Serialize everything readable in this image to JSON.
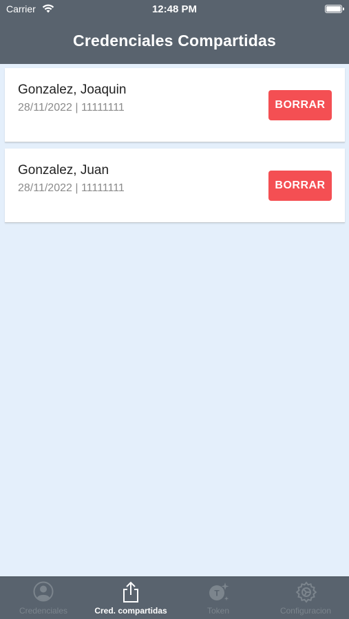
{
  "status_bar": {
    "carrier": "Carrier",
    "time": "12:48 PM"
  },
  "nav": {
    "title": "Credenciales Compartidas"
  },
  "credentials": [
    {
      "name": "Gonzalez, Joaquin",
      "meta": "28/11/2022 | 11111111",
      "button": "BORRAR"
    },
    {
      "name": "Gonzalez, Juan",
      "meta": "28/11/2022 | 11111111",
      "button": "BORRAR"
    }
  ],
  "tabs": [
    {
      "label": "Credenciales",
      "icon": "person-icon",
      "active": false
    },
    {
      "label": "Cred. compartidas",
      "icon": "share-icon",
      "active": true
    },
    {
      "label": "Token",
      "icon": "token-icon",
      "active": false
    },
    {
      "label": "Configuracion",
      "icon": "gear-icon",
      "active": false
    }
  ],
  "colors": {
    "header": "#59636e",
    "background": "#e4effb",
    "delete": "#f44f53",
    "tab_inactive": "#7c858d",
    "tab_active": "#ffffff"
  }
}
